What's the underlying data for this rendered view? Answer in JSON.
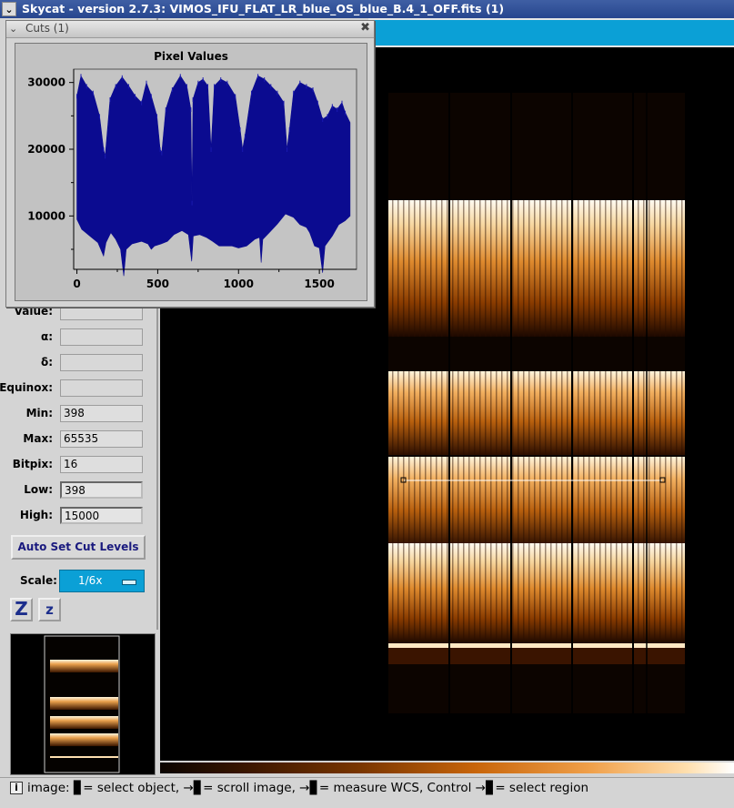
{
  "window": {
    "title": "Skycat - version 2.7.3: VIMOS_IFU_FLAT_LR_blue_OS_blue_B.4_1_OFF.fits (1)",
    "menu_glyph": "⌄"
  },
  "cuts_dialog": {
    "title": "Cuts (1)",
    "close_glyph": "✖",
    "menu_glyph": "⌄"
  },
  "chart_data": {
    "type": "area",
    "title": "Pixel Values",
    "xlabel": "",
    "ylabel": "",
    "xlim": [
      -20,
      1730
    ],
    "ylim": [
      2000,
      32000
    ],
    "x_ticks": [
      0,
      500,
      1000,
      1500
    ],
    "y_ticks": [
      10000,
      20000,
      30000
    ],
    "grid": false,
    "color": "#0b0b90",
    "series": [
      {
        "upper": [
          [
            0,
            28000
          ],
          [
            25,
            31000
          ],
          [
            60,
            29500
          ],
          [
            100,
            28500
          ],
          [
            140,
            25000
          ],
          [
            165,
            20000
          ],
          [
            175,
            19000
          ],
          [
            205,
            27500
          ],
          [
            240,
            29500
          ],
          [
            280,
            30800
          ],
          [
            320,
            29500
          ],
          [
            360,
            28000
          ],
          [
            400,
            27000
          ],
          [
            430,
            30000
          ],
          [
            460,
            28000
          ],
          [
            495,
            25000
          ],
          [
            515,
            20000
          ],
          [
            525,
            19500
          ],
          [
            550,
            26000
          ],
          [
            590,
            29000
          ],
          [
            640,
            31000
          ],
          [
            680,
            29500
          ],
          [
            705,
            26000
          ],
          [
            712,
            12000
          ],
          [
            718,
            27500
          ],
          [
            750,
            30000
          ],
          [
            780,
            30500
          ],
          [
            810,
            29500
          ],
          [
            830,
            20000
          ],
          [
            850,
            29500
          ],
          [
            890,
            30500
          ],
          [
            930,
            30000
          ],
          [
            980,
            28000
          ],
          [
            1010,
            23000
          ],
          [
            1025,
            20000
          ],
          [
            1040,
            22000
          ],
          [
            1080,
            28500
          ],
          [
            1120,
            31000
          ],
          [
            1160,
            30500
          ],
          [
            1200,
            29500
          ],
          [
            1240,
            28500
          ],
          [
            1280,
            27000
          ],
          [
            1300,
            20000
          ],
          [
            1315,
            23000
          ],
          [
            1340,
            28500
          ],
          [
            1380,
            30000
          ],
          [
            1420,
            29500
          ],
          [
            1460,
            29000
          ],
          [
            1490,
            27000
          ],
          [
            1520,
            24500
          ],
          [
            1550,
            25000
          ],
          [
            1580,
            26500
          ],
          [
            1610,
            26000
          ],
          [
            1640,
            27000
          ],
          [
            1660,
            25500
          ],
          [
            1690,
            24000
          ]
        ],
        "lower": [
          [
            0,
            9500
          ],
          [
            30,
            8000
          ],
          [
            80,
            7000
          ],
          [
            130,
            6000
          ],
          [
            165,
            4000
          ],
          [
            180,
            6000
          ],
          [
            210,
            7500
          ],
          [
            240,
            6500
          ],
          [
            270,
            5000
          ],
          [
            290,
            1000
          ],
          [
            305,
            5000
          ],
          [
            340,
            5800
          ],
          [
            400,
            6200
          ],
          [
            440,
            5800
          ],
          [
            460,
            5000
          ],
          [
            480,
            5500
          ],
          [
            520,
            5800
          ],
          [
            560,
            6200
          ],
          [
            600,
            7200
          ],
          [
            650,
            7800
          ],
          [
            690,
            7200
          ],
          [
            710,
            3200
          ],
          [
            720,
            7000
          ],
          [
            760,
            7200
          ],
          [
            800,
            6800
          ],
          [
            840,
            6200
          ],
          [
            880,
            5500
          ],
          [
            920,
            5500
          ],
          [
            960,
            5500
          ],
          [
            1000,
            5200
          ],
          [
            1050,
            5500
          ],
          [
            1100,
            6500
          ],
          [
            1130,
            6800
          ],
          [
            1140,
            3000
          ],
          [
            1150,
            6500
          ],
          [
            1190,
            7500
          ],
          [
            1240,
            8800
          ],
          [
            1290,
            10300
          ],
          [
            1340,
            9800
          ],
          [
            1380,
            8700
          ],
          [
            1420,
            8300
          ],
          [
            1440,
            7500
          ],
          [
            1470,
            5500
          ],
          [
            1500,
            5200
          ],
          [
            1520,
            1500
          ],
          [
            1535,
            5500
          ],
          [
            1580,
            7000
          ],
          [
            1620,
            8700
          ],
          [
            1660,
            9300
          ],
          [
            1690,
            10000
          ]
        ]
      }
    ]
  },
  "info_panel": {
    "fields": [
      {
        "label": "Value:",
        "value": ""
      },
      {
        "label": "α:",
        "value": ""
      },
      {
        "label": "δ:",
        "value": ""
      },
      {
        "label": "Equinox:",
        "value": ""
      },
      {
        "label": "Min:",
        "value": "398"
      },
      {
        "label": "Max:",
        "value": "65535"
      },
      {
        "label": "Bitpix:",
        "value": "16"
      },
      {
        "label": "Low:",
        "value": "398"
      },
      {
        "label": "High:",
        "value": "15000"
      }
    ],
    "auto_cut_label": "Auto Set Cut Levels",
    "scale_label": "Scale:",
    "scale_value": "1/6x",
    "zoom_in_glyph": "Z",
    "zoom_out_glyph": "z"
  },
  "status_bar": {
    "icon_glyph": "i",
    "text": "image: ▊= select object, →▊= scroll image, →▊= measure WCS, Control →▊= select region"
  },
  "colors": {
    "accent_blue": "#0ba0d6",
    "title_bar": "#27468e",
    "plot_line": "#0b0b90"
  }
}
